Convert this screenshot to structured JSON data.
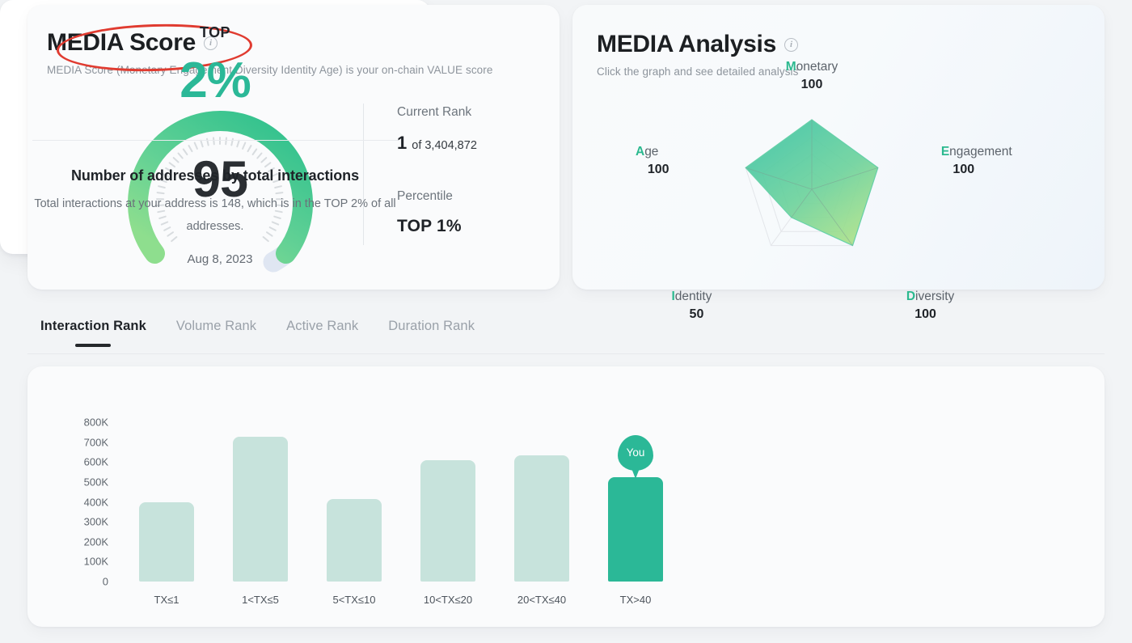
{
  "media_score": {
    "title": "MEDIA Score",
    "info_icon": "info-icon",
    "subtitle": "MEDIA Score (Monetary Engagement Diversity Identity Age) is your on-chain VALUE score",
    "gauge": {
      "value": "95",
      "value_number": 95,
      "max": 100,
      "date": "Aug 8, 2023",
      "arc_color_start": "#19b987",
      "arc_color_end": "#8ede8e",
      "track_color": "#dfe6f2"
    },
    "current_rank_label": "Current Rank",
    "current_rank_value": "1",
    "current_rank_of": "of 3,404,872",
    "percentile_label": "Percentile",
    "percentile_value": "TOP 1%"
  },
  "media_analysis": {
    "title": "MEDIA Analysis",
    "info_icon": "info-icon",
    "subtitle": "Click the graph and see detailed analysis",
    "chart_data": {
      "type": "radar",
      "title": "MEDIA Analysis",
      "max": 100,
      "categories": [
        "Monetary",
        "Engagement",
        "Diversity",
        "Identity",
        "Age"
      ],
      "values": [
        100,
        100,
        100,
        50,
        100
      ],
      "initials": [
        "M",
        "E",
        "D",
        "I",
        "A"
      ],
      "rest": [
        "onetary",
        "ngagement",
        "iversity",
        "dentity",
        "ge"
      ],
      "accent_color": "#2bb98f",
      "fill_start": "#49c9a7",
      "fill_end": "#a9e08a",
      "grid": true,
      "legend": "none"
    }
  },
  "tabs": [
    {
      "label": "Interaction Rank",
      "active": true
    },
    {
      "label": "Volume Rank",
      "active": false
    },
    {
      "label": "Active Rank",
      "active": false
    },
    {
      "label": "Duration Rank",
      "active": false
    }
  ],
  "rank_chart": {
    "chart_data": {
      "type": "bar",
      "title": "Number of addresses by total interactions",
      "xlabel": "",
      "ylabel": "",
      "ylim": [
        0,
        800000
      ],
      "grid": false,
      "categories": [
        "TX≤1",
        "1<TX≤5",
        "5<TX≤10",
        "10<TX≤20",
        "20<TX≤40",
        "TX>40"
      ],
      "values": [
        400000,
        725000,
        415000,
        610000,
        635000,
        525000
      ],
      "tick_labels": [
        "800K",
        "700K",
        "600K",
        "500K",
        "400K",
        "300K",
        "200K",
        "100K",
        "0"
      ],
      "tick_values": [
        800000,
        700000,
        600000,
        500000,
        400000,
        300000,
        200000,
        100000,
        0
      ],
      "bar_color": "#c7e3dc",
      "highlight_color": "#2bb897",
      "highlight_index": 5,
      "highlight_marker": "You"
    }
  },
  "top_panel": {
    "top_word": "TOP",
    "top_percent": "2%",
    "heading": "Number of addresses by total interactions",
    "description": "Total interactions at your address is 148, which is in the TOP 2% of all addresses."
  }
}
